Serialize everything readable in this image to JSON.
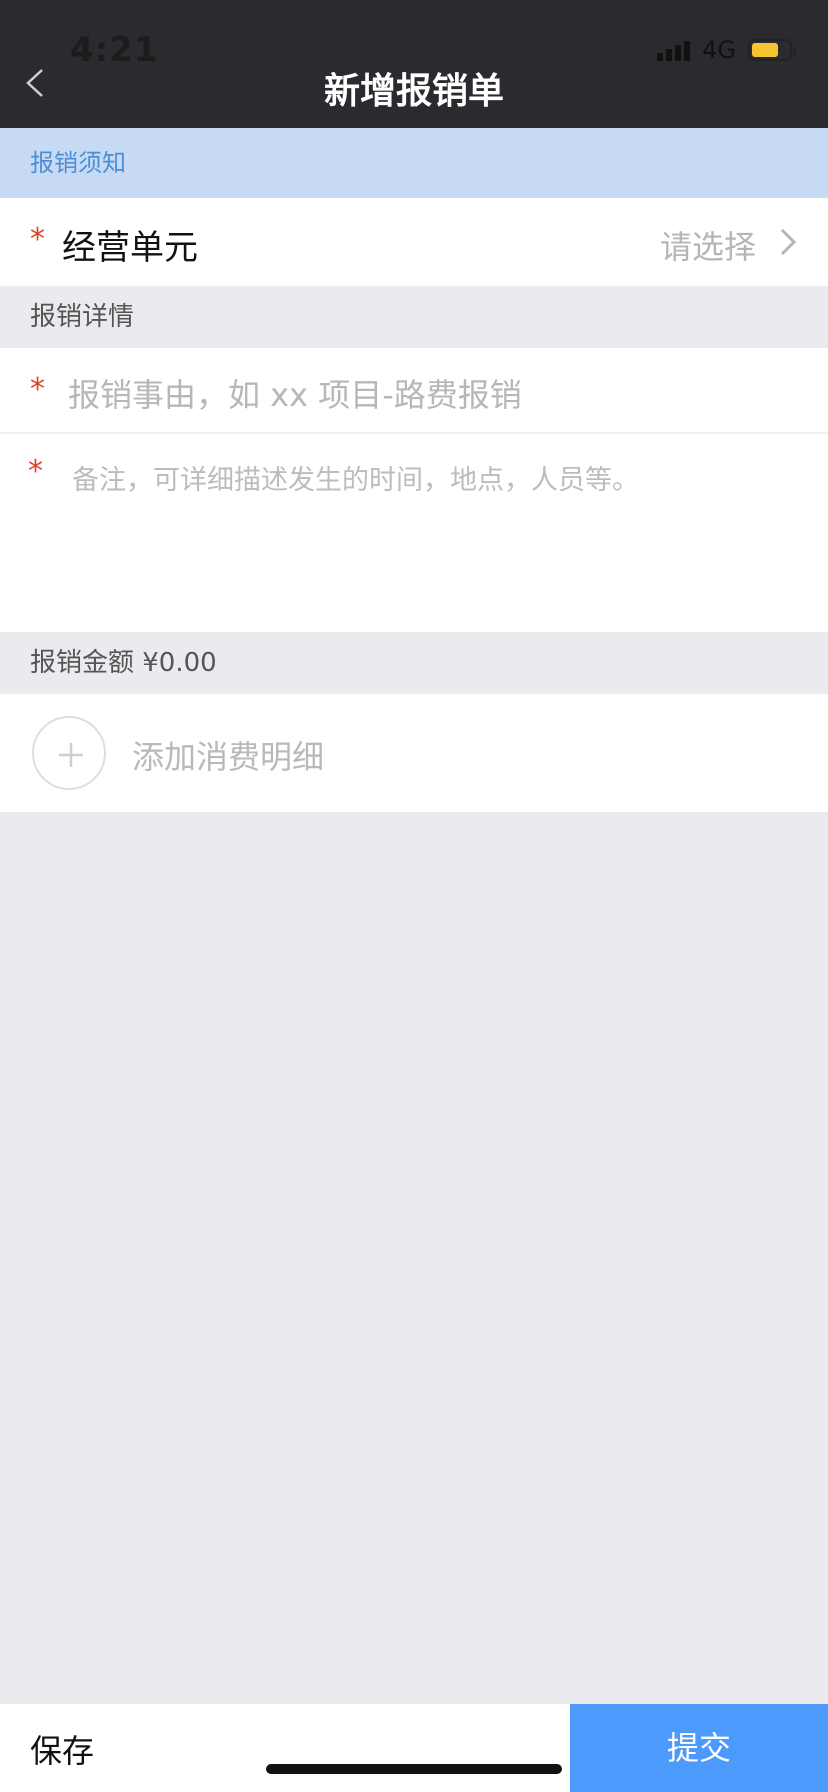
{
  "status_bar": {
    "time": "4:21",
    "network": "4G"
  },
  "header": {
    "title": "新增报销单"
  },
  "notice": {
    "label": "报销须知"
  },
  "unit_row": {
    "required_mark": "*",
    "label": "经营单元",
    "value": "请选择"
  },
  "details_section": {
    "title": "报销详情"
  },
  "reason": {
    "required_mark": "*",
    "placeholder": "报销事由，如 xx 项目-路费报销"
  },
  "notes": {
    "required_mark": "*",
    "placeholder": "备注，可详细描述发生的时间，地点，人员等。"
  },
  "amount_section": {
    "title": "报销金额 ¥0.00"
  },
  "add_item": {
    "label": "添加消费明细"
  },
  "footer": {
    "save_label": "保存",
    "submit_label": "提交"
  },
  "colors": {
    "header_bg": "#2b2b2f",
    "notice_bg": "#c7daf3",
    "accent": "#4c9afb",
    "required": "#d8452b"
  }
}
